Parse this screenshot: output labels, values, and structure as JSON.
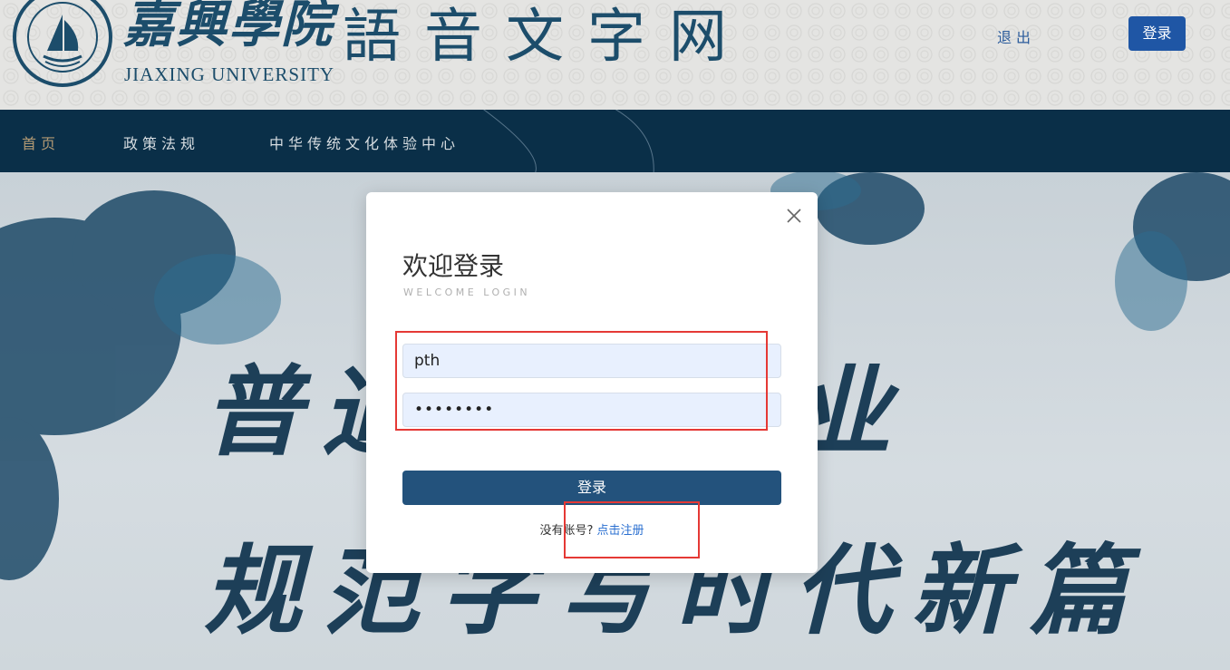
{
  "header": {
    "university_cn": "嘉興學院",
    "university_en": "JIAXING UNIVERSITY",
    "site_title": "語音文字网",
    "logout_label": "退出",
    "login_label": "登录"
  },
  "nav": {
    "items": [
      {
        "label": "首页",
        "active": true
      },
      {
        "label": "政策法规",
        "active": false
      },
      {
        "label": "中华传统文化体验中心",
        "active": false
      }
    ]
  },
  "banner": {
    "line1": "普通话年伟业",
    "line2": "规范字写时代新篇"
  },
  "modal": {
    "title": "欢迎登录",
    "subtitle": "WELCOME LOGIN",
    "username_value": "pth",
    "password_value": "••••••••",
    "submit_label": "登录",
    "register_prompt": "没有账号?",
    "register_link": "点击注册"
  },
  "colors": {
    "nav_bg": "#0a2f48",
    "brand_blue": "#1f56a5",
    "submit_bg": "#23527c",
    "input_bg": "#e8f0fe",
    "highlight": "#e53935"
  }
}
